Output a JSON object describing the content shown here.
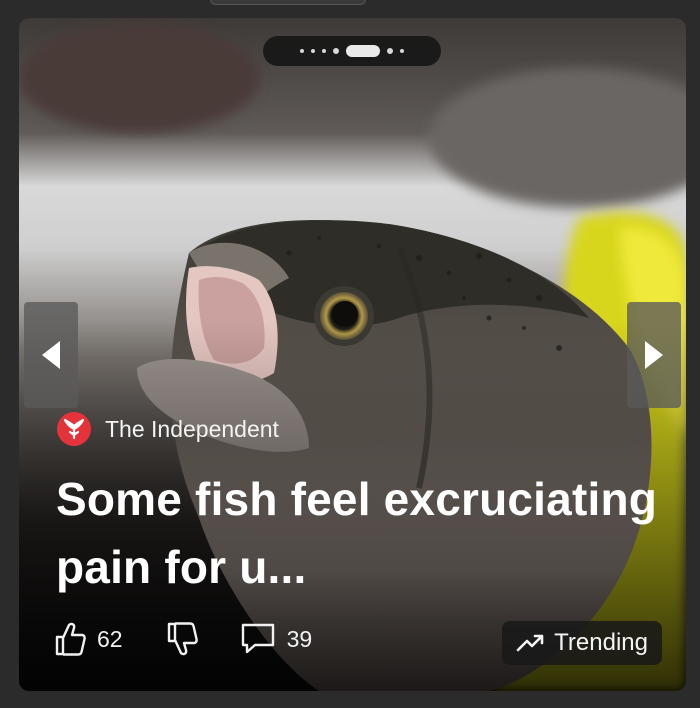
{
  "card": {
    "source": {
      "name": "The Independent",
      "logo_icon": "independent-eagle-logo",
      "logo_color": "#e4333b"
    },
    "headline": "Some fish feel excruciating pain for u...",
    "carousel": {
      "total": 7,
      "active_index": 4
    },
    "actions": {
      "likes": "62",
      "comments": "39"
    },
    "badge": {
      "label": "Trending",
      "icon": "trending-up-icon"
    }
  }
}
